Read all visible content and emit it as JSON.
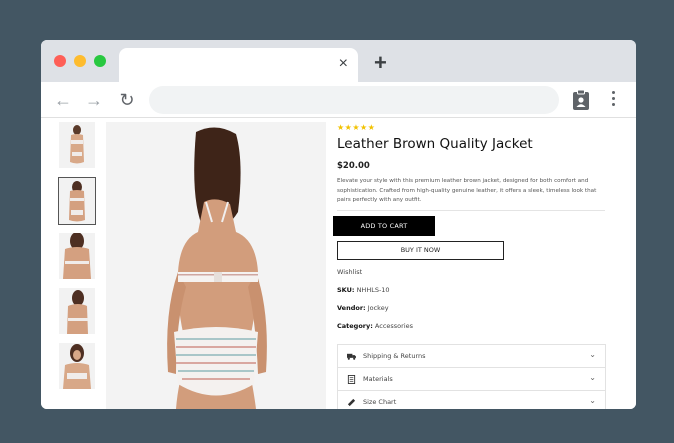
{
  "browser": {
    "tab_close": "×",
    "new_tab": "+",
    "nav": {
      "back": "←",
      "forward": "→",
      "reload": "↻"
    },
    "address": "",
    "icons": [
      "back-arrow-icon",
      "forward-arrow-icon",
      "reload-icon",
      "clipboard-user-icon",
      "kebab-menu-icon"
    ]
  },
  "product": {
    "rating": "★★★★★",
    "title": "Leather Brown Quality Jacket",
    "price": "$20.00",
    "description": "Elevate your style with this premium leather brown jacket, designed for both comfort and sophistication. Crafted from high-quality genuine leather, it offers a sleek, timeless look that pairs perfectly with any outfit.",
    "add_to_cart": "ADD TO CART",
    "buy_now": "BUY IT NOW",
    "wishlist": "Wishlist",
    "sku_label": "SKU:",
    "sku_value": "NHHLS-10",
    "vendor_label": "Vendor:",
    "vendor_value": "Jockey",
    "category_label": "Category:",
    "category_value": "Accessories",
    "accordion": [
      {
        "label": "Shipping & Returns",
        "icon": "truck-icon"
      },
      {
        "label": "Materials",
        "icon": "fabric-icon"
      },
      {
        "label": "Size Chart",
        "icon": "ruler-icon"
      }
    ],
    "thumbnails": [
      "front-view",
      "back-view",
      "back-closeup",
      "side-view",
      "front-closeup"
    ],
    "colors": {
      "star": "#f2c200",
      "button_bg": "#000000",
      "window_bg": "#435663"
    }
  }
}
